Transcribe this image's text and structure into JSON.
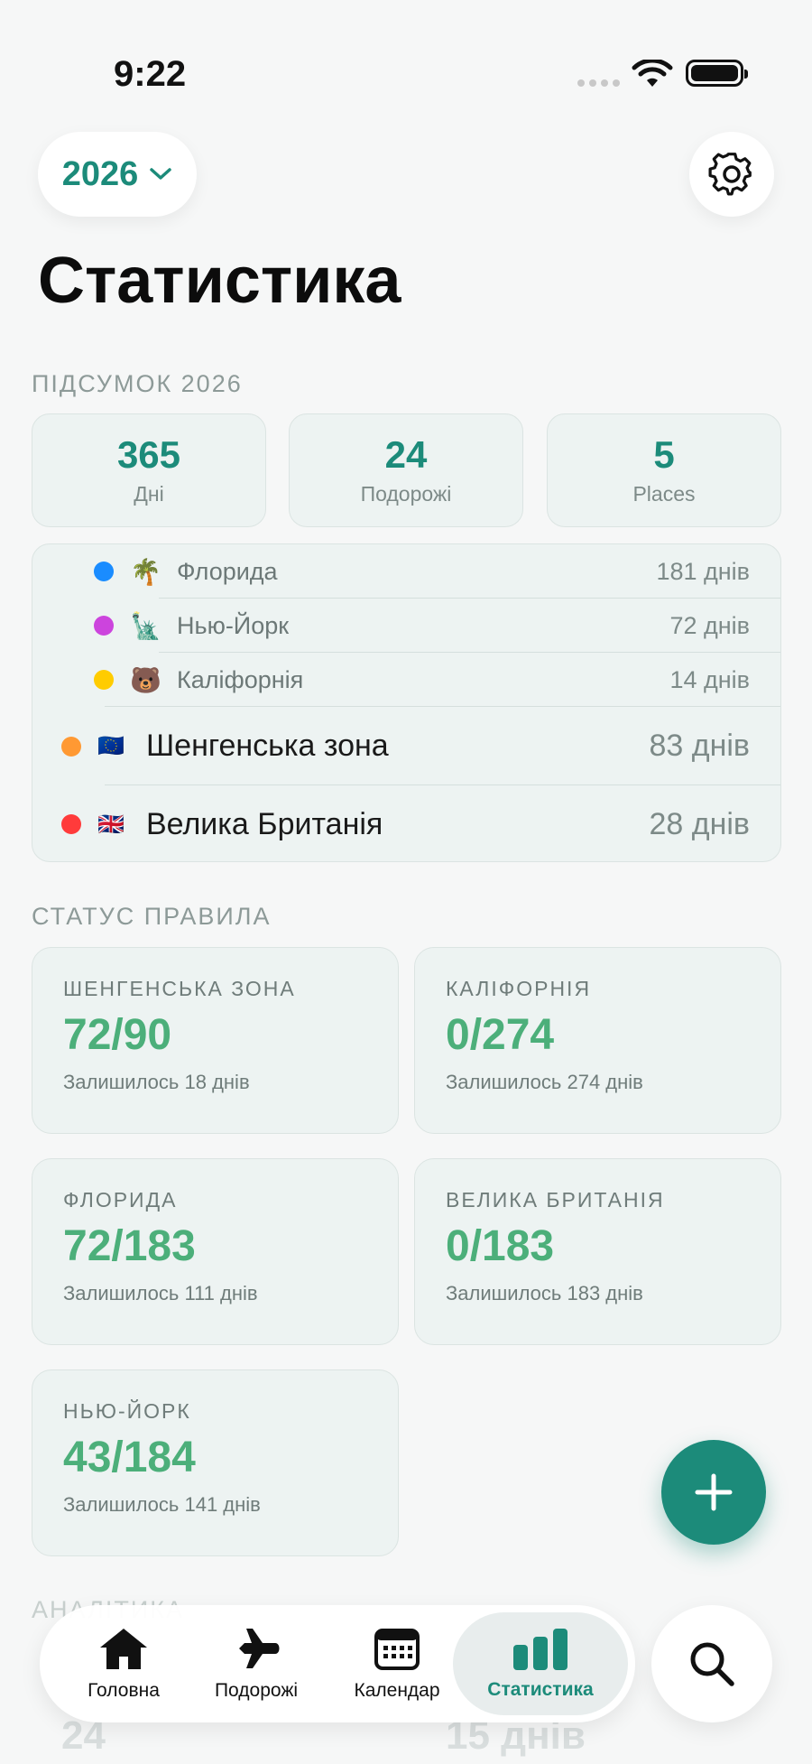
{
  "status_bar": {
    "time": "9:22"
  },
  "header": {
    "year": "2026",
    "title": "Статистика"
  },
  "summary": {
    "label": "ПІДСУМОК 2026",
    "stats": [
      {
        "value": "365",
        "label": "Дні"
      },
      {
        "value": "24",
        "label": "Подорожі"
      },
      {
        "value": "5",
        "label": "Places"
      }
    ]
  },
  "regions": [
    {
      "name": "Флорида",
      "days": "181 днів",
      "emoji": "🌴",
      "color": "#1a8cff"
    },
    {
      "name": "Нью-Йорк",
      "days": "72 днів",
      "emoji": "🗽",
      "color": "#cc44dd"
    },
    {
      "name": "Каліфорнія",
      "days": "14 днів",
      "emoji": "🐻",
      "color": "#ffcc00"
    },
    {
      "name": "Шенгенська зона",
      "days": "83 днів",
      "emoji": "🇪🇺",
      "color": "#ff9933"
    },
    {
      "name": "Велика Британія",
      "days": "28 днів",
      "emoji": "🇬🇧",
      "color": "#ff3b3b"
    }
  ],
  "rules": {
    "label": "СТАТУС ПРАВИЛА",
    "cards": [
      {
        "title": "ШЕНГЕНСЬКА ЗОНА",
        "value": "72/90",
        "remaining": "Залишилось 18 днів"
      },
      {
        "title": "КАЛІФОРНІЯ",
        "value": "0/274",
        "remaining": "Залишилось 274 днів"
      },
      {
        "title": "ФЛОРИДА",
        "value": "72/183",
        "remaining": "Залишилось 111 днів"
      },
      {
        "title": "ВЕЛИКА БРИТАНІЯ",
        "value": "0/183",
        "remaining": "Залишилось 183 днів"
      },
      {
        "title": "НЬЮ-ЙОРК",
        "value": "43/184",
        "remaining": "Залишилось 141 днів"
      }
    ]
  },
  "analytics": {
    "label": "АНАЛІТИКА",
    "value_left": "24",
    "value_right": "15 днів"
  },
  "tabs": [
    {
      "label": "Головна",
      "icon": "house-icon"
    },
    {
      "label": "Подорожі",
      "icon": "airplane-icon"
    },
    {
      "label": "Календар",
      "icon": "calendar-icon"
    },
    {
      "label": "Статистика",
      "icon": "bar-chart-icon"
    }
  ],
  "colors": {
    "accent": "#1c8b7a",
    "rule_value": "#4caf7a"
  }
}
